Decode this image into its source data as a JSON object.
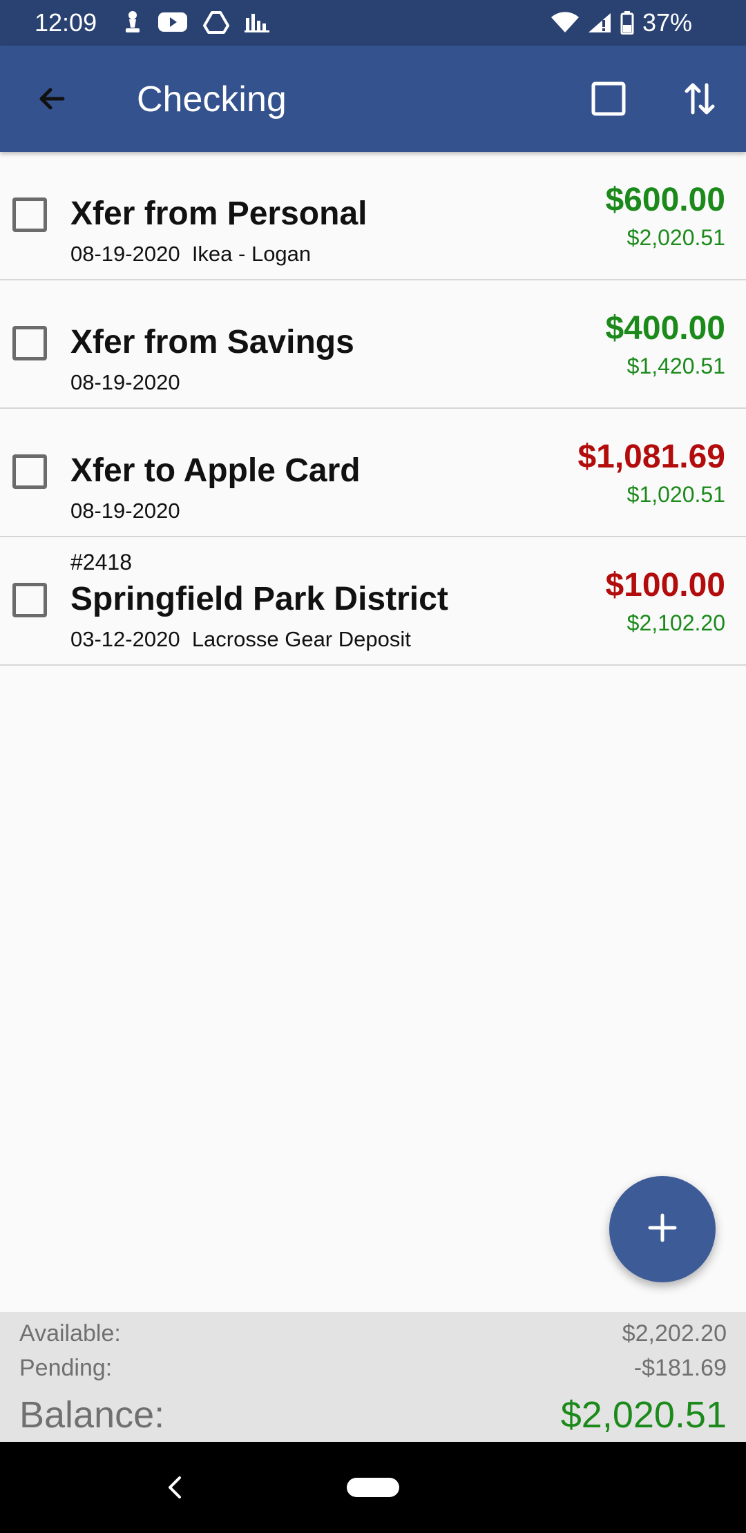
{
  "status_bar": {
    "time": "12:09",
    "battery": "37%",
    "icons": [
      "chess-icon",
      "youtube-icon",
      "drive-icon",
      "chart-icon",
      "wifi-icon",
      "signal-icon",
      "battery-icon"
    ]
  },
  "app_bar": {
    "title": "Checking",
    "icons": [
      "back-arrow-icon",
      "select-all-icon",
      "sort-icon"
    ]
  },
  "transactions": [
    {
      "number": "",
      "name": "Xfer from Personal",
      "date": "08-19-2020",
      "memo": "Ikea - Logan",
      "amount": "$600.00",
      "amount_type": "credit",
      "running_balance": "$2,020.51"
    },
    {
      "number": "",
      "name": "Xfer from Savings",
      "date": "08-19-2020",
      "memo": "",
      "amount": "$400.00",
      "amount_type": "credit",
      "running_balance": "$1,420.51"
    },
    {
      "number": "",
      "name": "Xfer to Apple Card",
      "date": "08-19-2020",
      "memo": "",
      "amount": "$1,081.69",
      "amount_type": "debit",
      "running_balance": "$1,020.51"
    },
    {
      "number": "#2418",
      "name": "Springfield Park District",
      "date": "03-12-2020",
      "memo": "Lacrosse Gear Deposit",
      "amount": "$100.00",
      "amount_type": "debit",
      "running_balance": "$2,102.20"
    }
  ],
  "fab": {
    "icon": "plus-icon"
  },
  "summary": {
    "available_label": "Available:",
    "available_value": "$2,202.20",
    "pending_label": "Pending:",
    "pending_value": "-$181.69",
    "balance_label": "Balance:",
    "balance_value": "$2,020.51"
  },
  "colors": {
    "app_bar": "#34528e",
    "status_bar": "#2a4272",
    "credit": "#1b8a1b",
    "debit": "#b30c0c",
    "fab": "#3d5b97"
  }
}
